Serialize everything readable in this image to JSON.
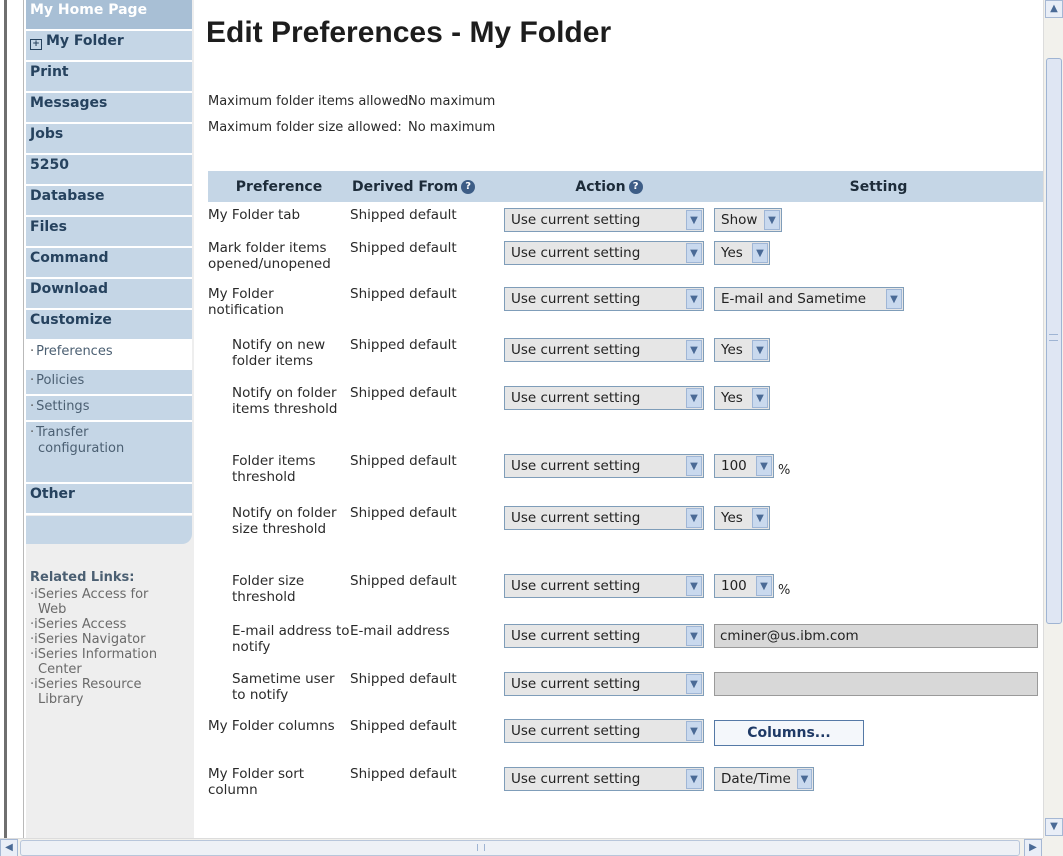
{
  "nav": {
    "home_label": "My Home Page",
    "my_folder_label": "My Folder",
    "items": [
      {
        "label": "Print"
      },
      {
        "label": "Messages"
      },
      {
        "label": "Jobs"
      },
      {
        "label": "5250"
      },
      {
        "label": "Database"
      },
      {
        "label": "Files"
      },
      {
        "label": "Command"
      },
      {
        "label": "Download"
      },
      {
        "label": "Customize"
      }
    ],
    "sub_items": [
      {
        "label": "Preferences"
      },
      {
        "label": "Policies"
      },
      {
        "label": "Settings"
      },
      {
        "label": "Transfer",
        "label2": "configuration"
      }
    ],
    "other_label": "Other",
    "related_title": "Related Links:",
    "related_links": [
      {
        "l1": "iSeries Access for",
        "l2": "Web"
      },
      {
        "l1": "iSeries Access",
        "l2": ""
      },
      {
        "l1": "iSeries Navigator",
        "l2": ""
      },
      {
        "l1": "iSeries Information",
        "l2": "Center"
      },
      {
        "l1": "iSeries Resource",
        "l2": "Library"
      }
    ]
  },
  "page": {
    "title": "Edit Preferences - My Folder",
    "max_items_label": "Maximum folder items allowed:",
    "max_items_value": "No maximum",
    "max_size_label": "Maximum folder size allowed:",
    "max_size_value": "No maximum"
  },
  "table": {
    "headers": {
      "preference": "Preference",
      "derived": "Derived From",
      "action": "Action",
      "setting": "Setting"
    },
    "help_icon": "question-circle-icon",
    "action_default": "Use current setting",
    "rows": [
      {
        "pref": "My Folder tab",
        "derived": "Shipped default",
        "setting": "Show"
      },
      {
        "pref": "Mark folder items opened/unopened",
        "derived": "Shipped default",
        "setting": "Yes"
      },
      {
        "pref": "My Folder notification",
        "derived": "Shipped default",
        "setting": "E-mail and Sametime"
      },
      {
        "pref": "Notify on new folder items",
        "derived": "Shipped default",
        "setting": "Yes"
      },
      {
        "pref": "Notify on folder items threshold",
        "derived": "Shipped default",
        "setting": "Yes"
      },
      {
        "pref": "Folder items threshold",
        "derived": "Shipped default",
        "setting": "100",
        "unit": "%"
      },
      {
        "pref": "Notify on folder size threshold",
        "derived": "Shipped default",
        "setting": "Yes"
      },
      {
        "pref": "Folder size threshold",
        "derived": "Shipped default",
        "setting": "100",
        "unit": "%"
      },
      {
        "pref": "E-mail address to notify",
        "derived": "E-mail address",
        "setting": "cminer@us.ibm.com"
      },
      {
        "pref": "Sametime user to notify",
        "derived": "Shipped default",
        "setting": ""
      },
      {
        "pref": "My Folder columns",
        "derived": "Shipped default",
        "setting": "Columns..."
      },
      {
        "pref": "My Folder sort column",
        "derived": "Shipped default",
        "setting": "Date/Time"
      }
    ]
  },
  "colors": {
    "nav_bg": "#c5d6e6",
    "header_bg": "#c5d6e6",
    "nav_text": "#26425e"
  }
}
